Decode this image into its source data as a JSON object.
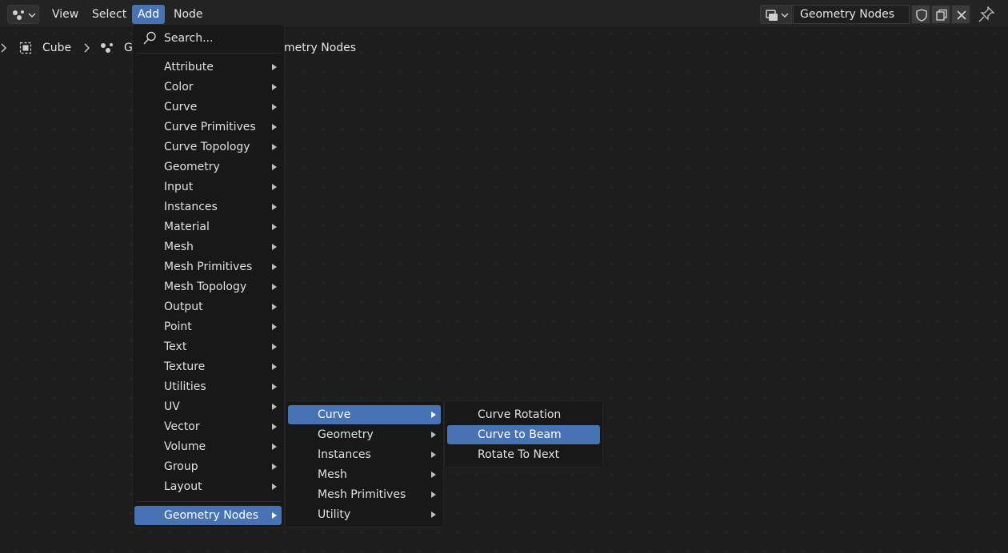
{
  "header": {
    "menus": [
      "View",
      "Select",
      "Add",
      "Node"
    ],
    "active_menu": "Add",
    "node_tree_name": "Geometry Nodes"
  },
  "breadcrumb": {
    "object": "Cube",
    "modifier_start": "G",
    "modifier_end": "metry Nodes"
  },
  "add_menu": {
    "search": "Search...",
    "items": [
      "Attribute",
      "Color",
      "Curve",
      "Curve Primitives",
      "Curve Topology",
      "Geometry",
      "Input",
      "Instances",
      "Material",
      "Mesh",
      "Mesh Primitives",
      "Mesh Topology",
      "Output",
      "Point",
      "Text",
      "Texture",
      "Utilities",
      "UV",
      "Vector",
      "Volume",
      "Group",
      "Layout"
    ],
    "highlighted": "Geometry Nodes"
  },
  "geometry_nodes_menu": {
    "items": [
      "Curve",
      "Geometry",
      "Instances",
      "Mesh",
      "Mesh Primitives",
      "Utility"
    ]
  },
  "curve_menu": {
    "items": [
      "Curve Rotation",
      "Curve to Beam",
      "Rotate To Next"
    ],
    "highlighted_index": 1
  },
  "colors": {
    "highlight": "#4772b3",
    "background": "#1d1d1d",
    "menu_bg": "#181818"
  }
}
